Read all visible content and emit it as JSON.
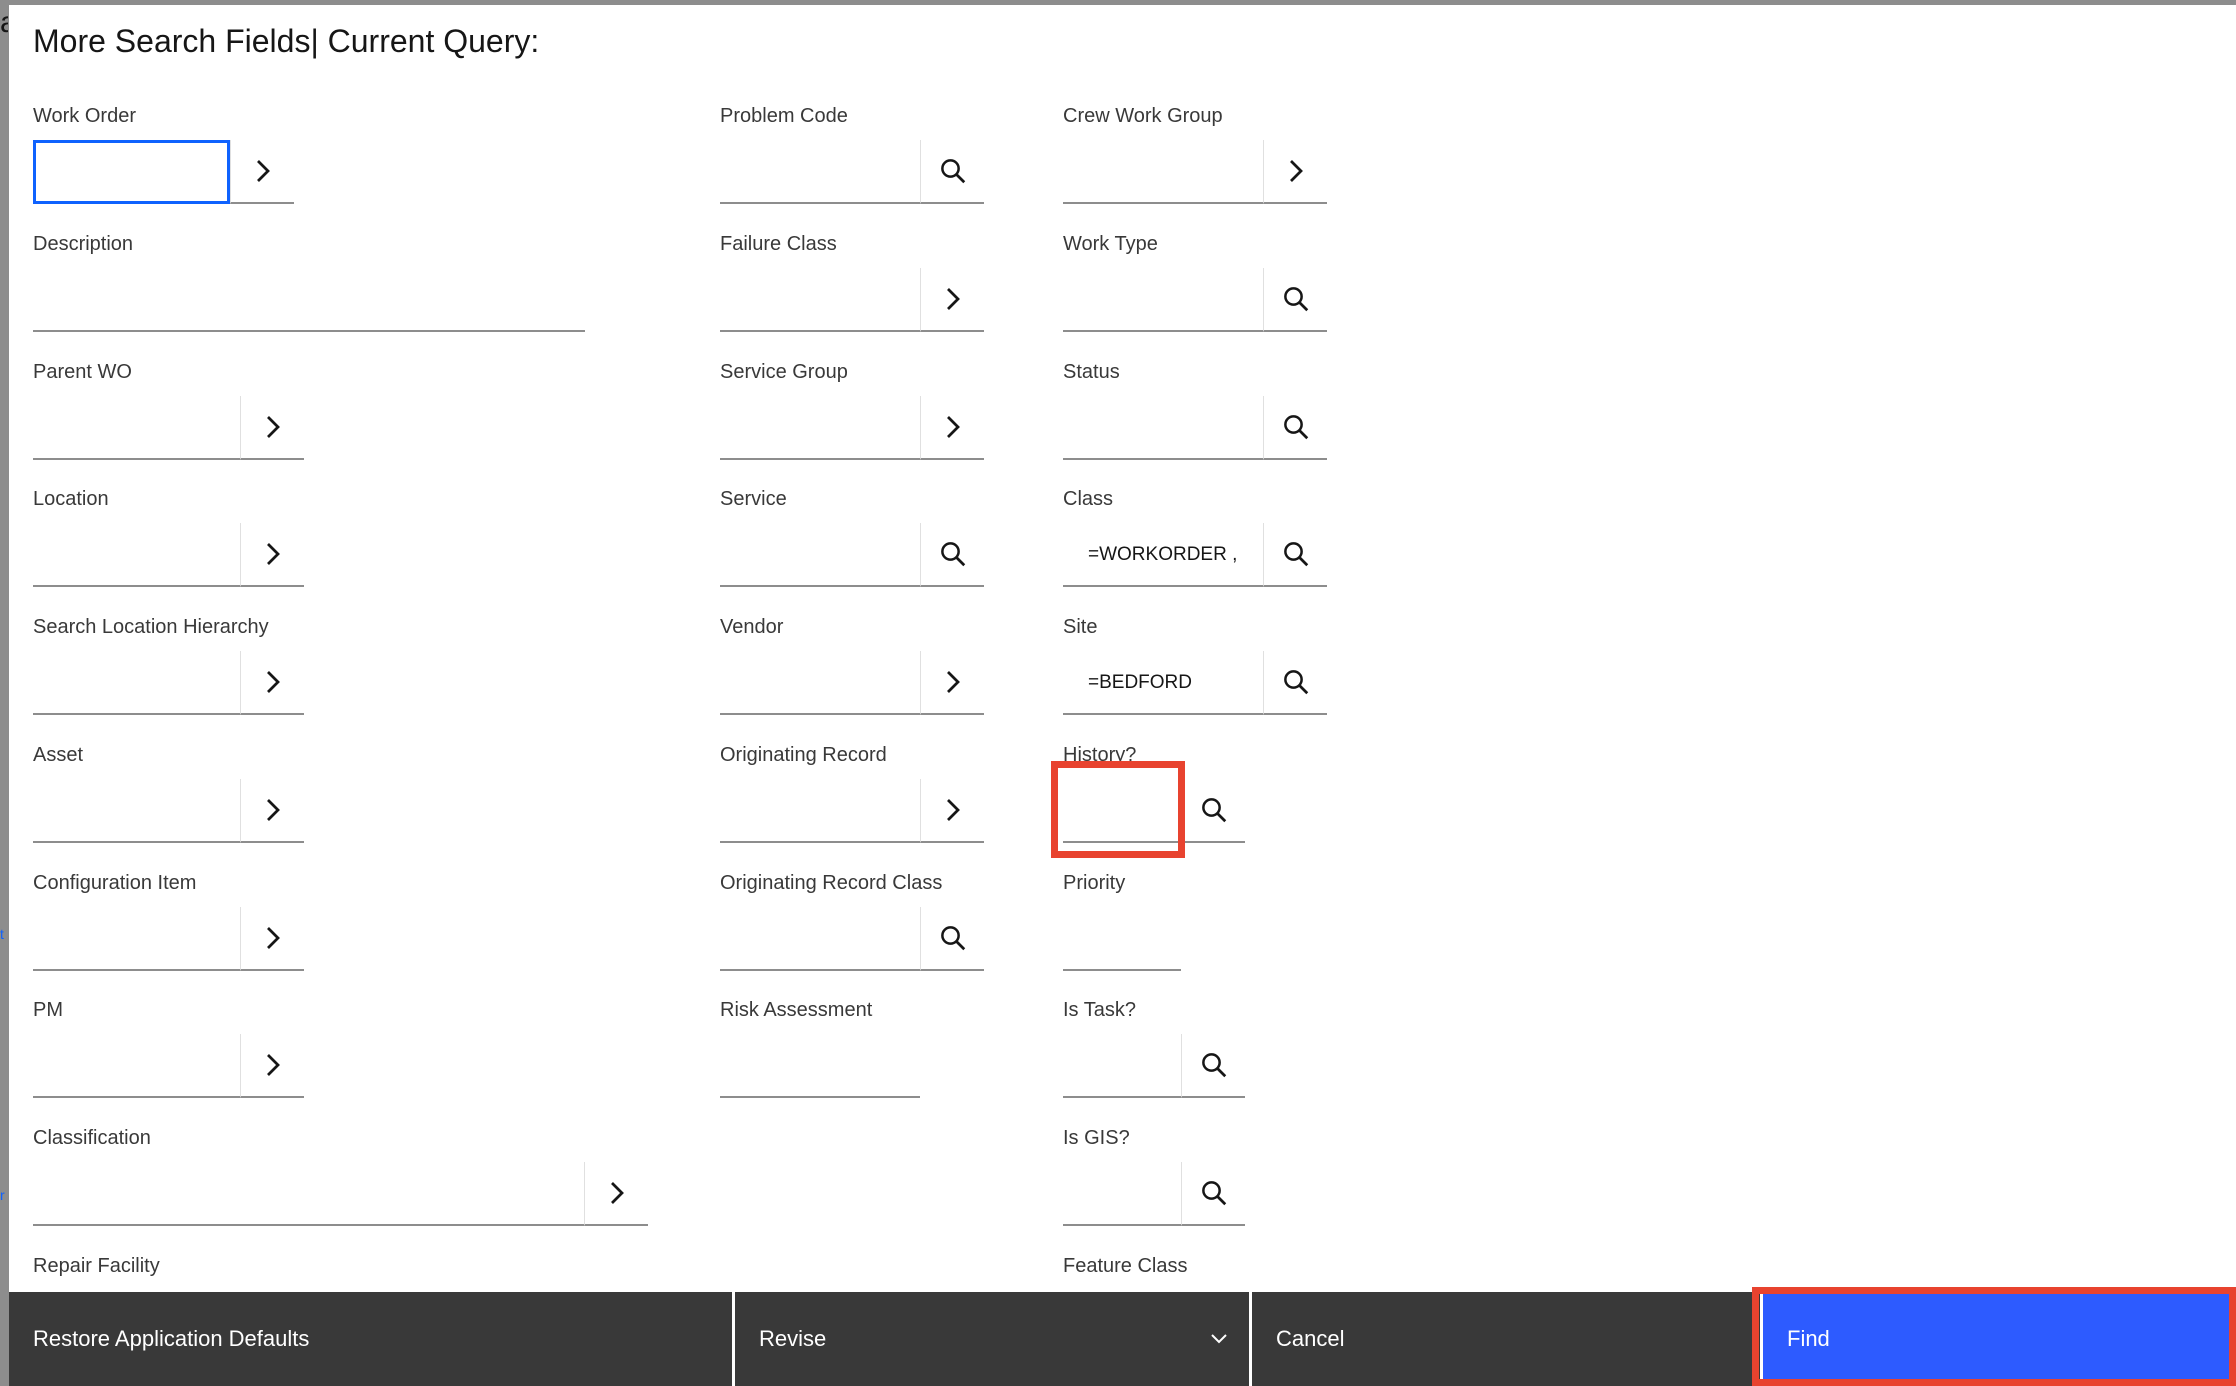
{
  "background": {
    "clip_top": "a",
    "clip_mid": "t",
    "clip_low": "r"
  },
  "dialog": {
    "title": "More Search Fields| Current Query:"
  },
  "fields": {
    "work_order": {
      "label": "Work Order",
      "value": ""
    },
    "description": {
      "label": "Description",
      "value": ""
    },
    "parent_wo": {
      "label": "Parent WO",
      "value": ""
    },
    "location": {
      "label": "Location",
      "value": ""
    },
    "search_location_hierarchy": {
      "label": "Search Location Hierarchy",
      "value": ""
    },
    "asset": {
      "label": "Asset",
      "value": ""
    },
    "configuration_item": {
      "label": "Configuration Item",
      "value": ""
    },
    "pm": {
      "label": "PM",
      "value": ""
    },
    "classification": {
      "label": "Classification",
      "value": ""
    },
    "repair_facility": {
      "label": "Repair Facility"
    },
    "problem_code": {
      "label": "Problem Code",
      "value": ""
    },
    "failure_class": {
      "label": "Failure Class",
      "value": ""
    },
    "service_group": {
      "label": "Service Group",
      "value": ""
    },
    "service": {
      "label": "Service",
      "value": ""
    },
    "vendor": {
      "label": "Vendor",
      "value": ""
    },
    "originating_record": {
      "label": "Originating Record",
      "value": ""
    },
    "originating_record_class": {
      "label": "Originating Record Class",
      "value": ""
    },
    "risk_assessment": {
      "label": "Risk Assessment",
      "value": ""
    },
    "crew_work_group": {
      "label": "Crew Work Group",
      "value": ""
    },
    "work_type": {
      "label": "Work Type",
      "value": ""
    },
    "status": {
      "label": "Status",
      "value": ""
    },
    "class": {
      "label": "Class",
      "value": "=WORKORDER ,"
    },
    "site": {
      "label": "Site",
      "value": "=BEDFORD"
    },
    "history": {
      "label": "History?",
      "value": ""
    },
    "priority": {
      "label": "Priority",
      "value": ""
    },
    "is_task": {
      "label": "Is Task?",
      "value": ""
    },
    "is_gis": {
      "label": "Is GIS?",
      "value": ""
    },
    "feature_class": {
      "label": "Feature Class"
    }
  },
  "footer": {
    "restore_label": "Restore Application Defaults",
    "revise_label": "Revise",
    "cancel_label": "Cancel",
    "find_label": "Find"
  },
  "icons": {
    "arrow": "chevron-right-icon",
    "lookup": "search-icon",
    "dropdown": "chevron-down-icon"
  },
  "colors": {
    "focus_border": "#0f62fe",
    "highlight": "#e8432f",
    "footer_dark": "#393939",
    "primary_button": "#2d5bff"
  }
}
